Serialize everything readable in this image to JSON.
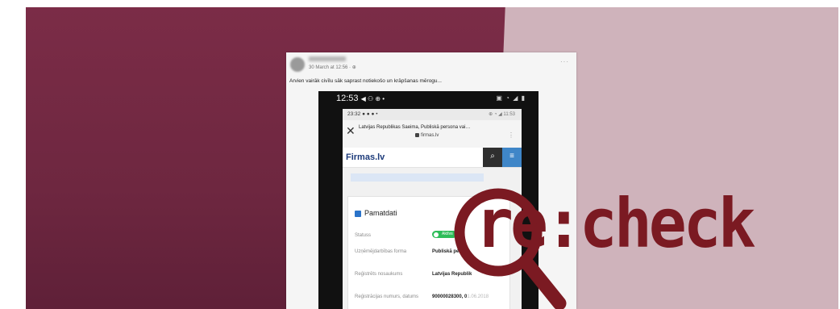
{
  "post": {
    "time": "30 March at 12:56 · ⊕",
    "text": "Arvien vairāk civīlu sāk saprast notiekošo un krāpšanas mērogu...",
    "more": "···"
  },
  "phone": {
    "status_time": "12:53",
    "status_glyphs": "◀ ⚇ ⊕ •",
    "status_icons": "▣ ◔ ◢ ▮"
  },
  "inner": {
    "status_time": "23:32 ● ● ● •",
    "status_icons": "⊕ ◔ ◢ 11:53",
    "browser": {
      "close": "✕",
      "title": "Latvijas Republikas Saeima, Publiskā persona vai…",
      "url": "firmas.lv",
      "menu": "⋮"
    },
    "site": {
      "logo": "Firmas.lv",
      "search_glyph": "⌕",
      "menu_glyph": "≡"
    },
    "details": {
      "title": "Pamatdati",
      "rows": [
        {
          "label": "Statuss",
          "value": ""
        },
        {
          "label": "Uzņēmējdarbības forma",
          "value": "Publiskā pe"
        },
        {
          "label": "Reģistrēts nosaukums",
          "value": "Latvijas Republik"
        },
        {
          "label": "Reģistrācijas numurs, datums",
          "value": "90000028300, 0",
          "value_extra": "1.06.2018"
        }
      ],
      "status_badge": "Aktīvs"
    }
  },
  "logo": {
    "text": "re:check",
    "color": "#7b1a22"
  },
  "colors": {
    "background_left": "#7b2c47",
    "background_right": "#cfb3bb",
    "accent_blue": "#2a73c9",
    "status_green": "#2ebd59"
  }
}
